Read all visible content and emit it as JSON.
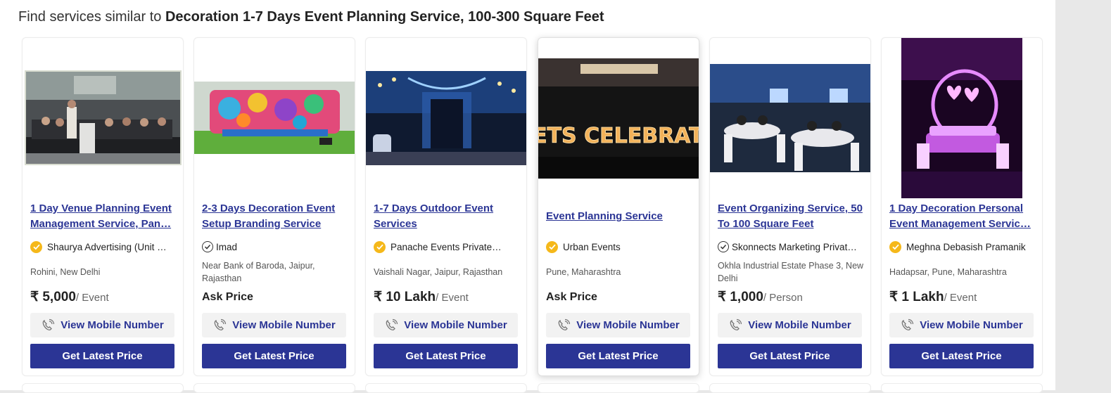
{
  "heading": {
    "prefix": "Find services similar to ",
    "product": "Decoration 1-7 Days Event Planning Service, 100-300 Square Feet"
  },
  "accent_color": "#2b3595",
  "badge_color": "#f5b81a",
  "cards": [
    {
      "title": "1 Day Venue Planning Event Management Service, Pan…",
      "seller": "Shaurya Advertising (Unit Of…",
      "seller_badge": "gold-check-icon",
      "location": "Rohini, New Delhi",
      "price": "₹ 5,000",
      "price_unit": "/ Event",
      "mobile_label": "View Mobile Number",
      "cta_label": "Get Latest Price"
    },
    {
      "title": "2-3 Days Decoration Event Setup Branding Service",
      "seller": "Imad",
      "seller_badge": "outline-check-icon",
      "location": "Near Bank of Baroda, Jaipur, Rajasthan",
      "price": "Ask Price",
      "price_unit": "",
      "mobile_label": "View Mobile Number",
      "cta_label": "Get Latest Price"
    },
    {
      "title": "1-7 Days Outdoor Event Services",
      "seller": "Panache Events Private…",
      "seller_badge": "gold-check-icon",
      "location": "Vaishali Nagar, Jaipur, Rajasthan",
      "price": "₹ 10 Lakh",
      "price_unit": "/ Event",
      "mobile_label": "View Mobile Number",
      "cta_label": "Get Latest Price"
    },
    {
      "title": "Event Planning Service",
      "seller": "Urban Events",
      "seller_badge": "gold-check-icon",
      "location": "Pune, Maharashtra",
      "price": "Ask Price",
      "price_unit": "",
      "mobile_label": "View Mobile Number",
      "cta_label": "Get Latest Price",
      "image_text": "LETS CELEBRATE"
    },
    {
      "title": "Event Organizing Service, 50 To 100 Square Feet",
      "seller": "Skonnects Marketing Private…",
      "seller_badge": "outline-check-icon",
      "location": "Okhla Industrial Estate Phase 3, New Delhi",
      "price": "₹ 1,000",
      "price_unit": "/ Person",
      "mobile_label": "View Mobile Number",
      "cta_label": "Get Latest Price"
    },
    {
      "title": "1 Day Decoration Personal Event Management Servic…",
      "seller": "Meghna Debasish Pramanik",
      "seller_badge": "gold-check-icon",
      "location": "Hadapsar, Pune, Maharashtra",
      "price": "₹ 1 Lakh",
      "price_unit": "/ Event",
      "mobile_label": "View Mobile Number",
      "cta_label": "Get Latest Price"
    }
  ]
}
